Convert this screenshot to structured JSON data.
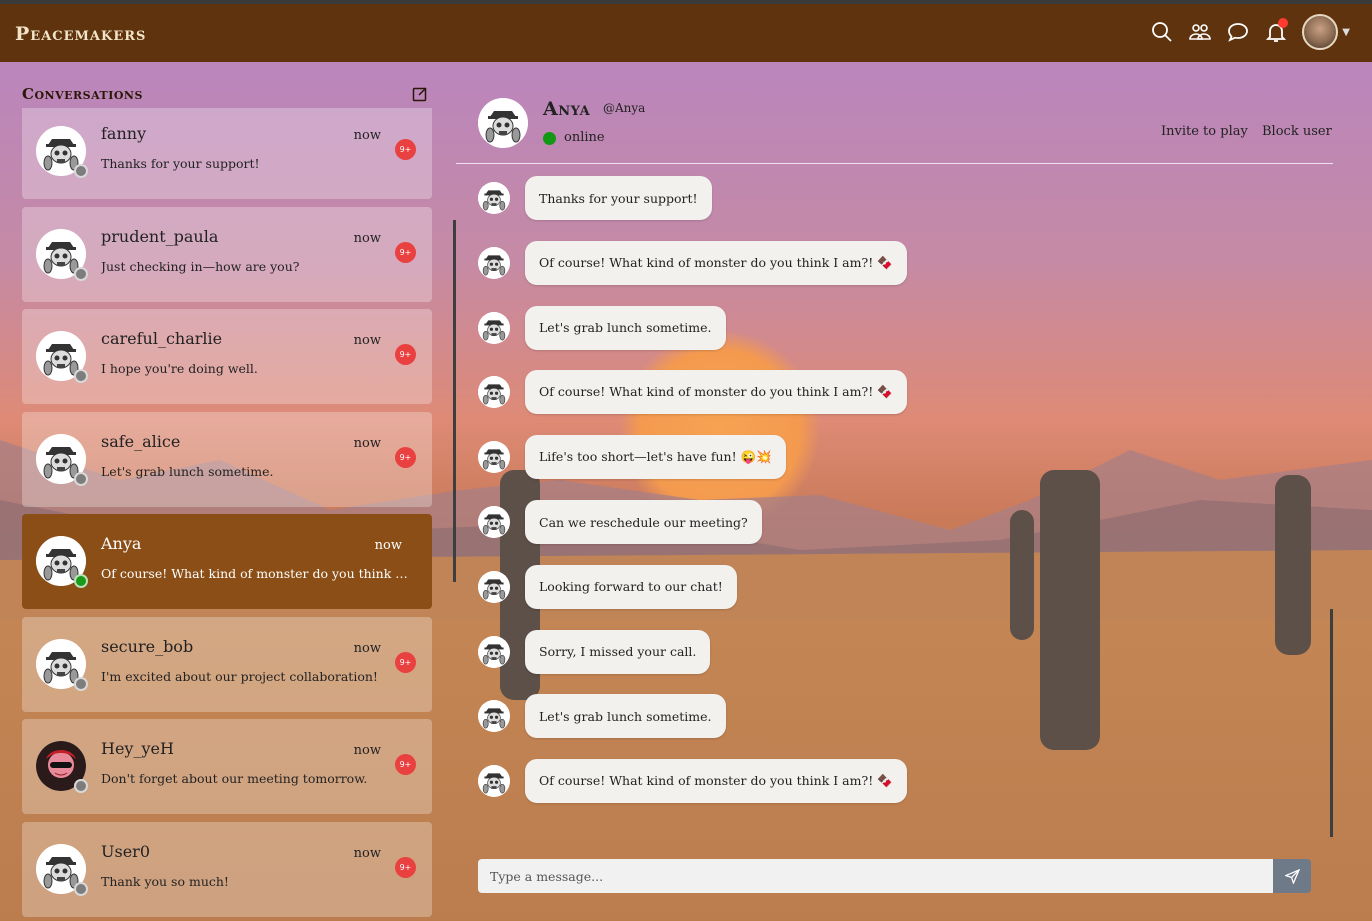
{
  "app": {
    "brand": "Peacemakers"
  },
  "nav": {
    "icons": [
      "search-icon",
      "friends-icon",
      "chat-bubble-icon",
      "bell-icon"
    ],
    "has_notification": true
  },
  "sidebar": {
    "title": "Conversations",
    "conversations": [
      {
        "name": "fanny",
        "time": "now",
        "preview": "Thanks for your support!",
        "badge": "9+",
        "online": false
      },
      {
        "name": "prudent_paula",
        "time": "now",
        "preview": "Just checking in—how are you?",
        "badge": "9+",
        "online": false
      },
      {
        "name": "careful_charlie",
        "time": "now",
        "preview": "I hope you're doing well.",
        "badge": "9+",
        "online": false
      },
      {
        "name": "safe_alice",
        "time": "now",
        "preview": "Let's grab lunch sometime.",
        "badge": "9+",
        "online": false
      },
      {
        "name": "Anya",
        "time": "now",
        "preview": "Of course! What kind of monster do you think I am...",
        "badge": "",
        "online": true,
        "active": true
      },
      {
        "name": "secure_bob",
        "time": "now",
        "preview": "I'm excited about our project collaboration!",
        "badge": "9+",
        "online": false
      },
      {
        "name": "Hey_yeH",
        "time": "now",
        "preview": "Don't forget about our meeting tomorrow.",
        "badge": "9+",
        "online": false
      },
      {
        "name": "User0",
        "time": "now",
        "preview": "Thank you so much!",
        "badge": "9+",
        "online": false
      }
    ]
  },
  "chat": {
    "name": "Anya",
    "handle": "@Anya",
    "status": "online",
    "invite_label": "Invite to play",
    "block_label": "Block user",
    "messages": [
      "Thanks for your support!",
      "Of course! What kind of monster do you think I am?! 🍫",
      "Let's grab lunch sometime.",
      "Of course! What kind of monster do you think I am?! 🍫",
      "Life's too short—let's have fun! 😜💥",
      "Can we reschedule our meeting?",
      "Looking forward to our chat!",
      "Sorry, I missed your call.",
      "Let's grab lunch sometime.",
      "Of course! What kind of monster do you think I am?! 🍫"
    ],
    "input_placeholder": "Type a message..."
  },
  "colors": {
    "navbar": "#5e330e",
    "active_conv": "#8a4e16",
    "badge": "#e94040",
    "online": "#129812"
  }
}
